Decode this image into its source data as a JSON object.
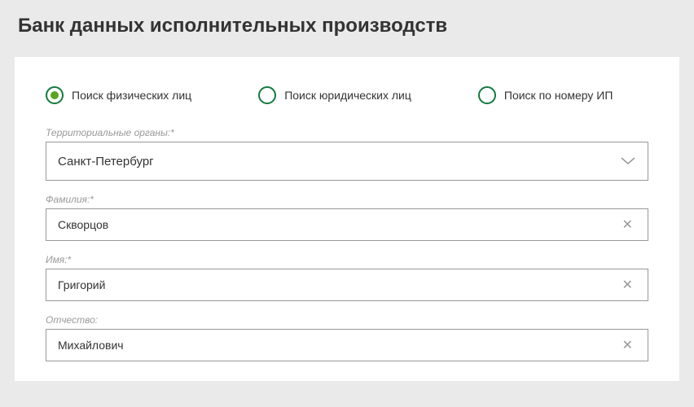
{
  "header": {
    "title": "Банк данных исполнительных производств"
  },
  "searchType": {
    "options": [
      {
        "label": "Поиск физических лиц",
        "selected": true
      },
      {
        "label": "Поиск юридических лиц",
        "selected": false
      },
      {
        "label": "Поиск по номеру ИП",
        "selected": false
      }
    ]
  },
  "fields": {
    "territory": {
      "label": "Территориальные органы:*",
      "value": "Санкт-Петербург"
    },
    "surname": {
      "label": "Фамилия:*",
      "value": "Скворцов"
    },
    "name": {
      "label": "Имя:*",
      "value": "Григорий"
    },
    "patronymic": {
      "label": "Отчество:",
      "value": "Михайлович"
    }
  }
}
